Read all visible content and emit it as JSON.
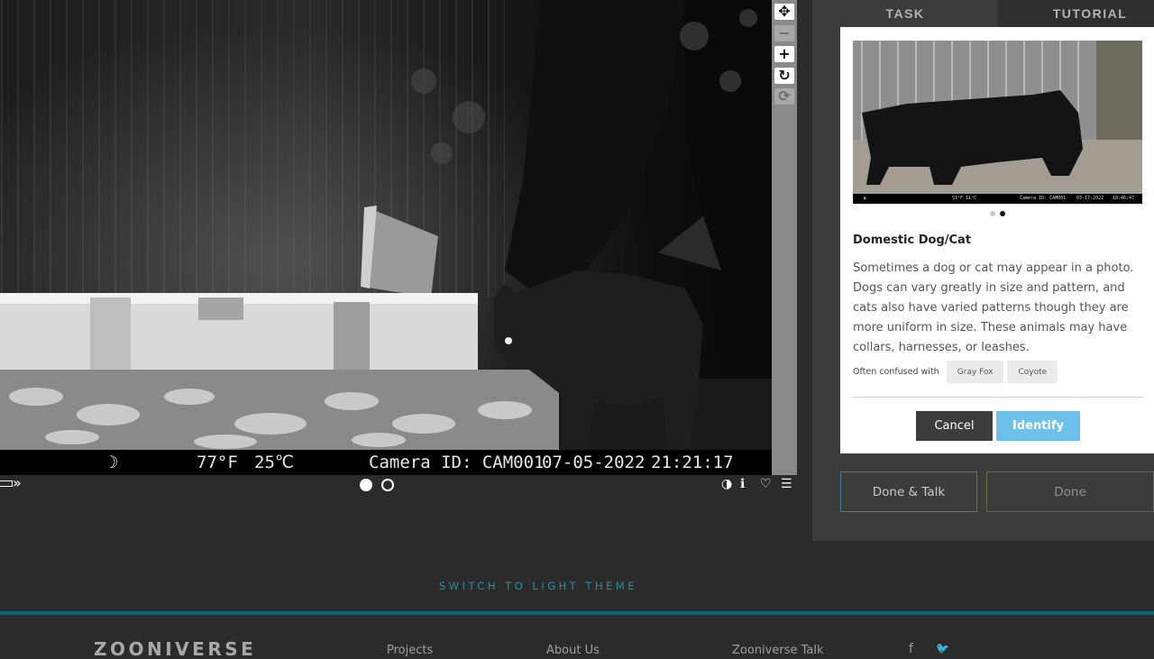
{
  "viewer": {
    "info_strip": {
      "moon": "☽",
      "temp_f": "77°F",
      "temp_c": "25℃",
      "camera_id": "Camera ID: CAM001",
      "date": "07-05-2022",
      "time": "21:21:17"
    },
    "tools": {
      "move": "✥",
      "zoom_out": "−",
      "zoom_in": "+",
      "rotate": "↻",
      "reset": "⟳"
    },
    "bar": {
      "expand": "»",
      "invert": "◑",
      "info": "ℹ",
      "favorite": "♡",
      "collections": "☰"
    }
  },
  "task_panel": {
    "tabs": {
      "task": "TASK",
      "tutorial": "TUTORIAL"
    },
    "species_card": {
      "photo_strip": {
        "moon": "◐",
        "temp": "51°F  11°C",
        "camera_id": "Camera ID: CAM001",
        "date": "03-17-2022",
        "time": "18:46:47"
      },
      "title": "Domestic Dog/Cat",
      "description": "Sometimes a dog or cat may appear in a photo. Dogs can vary greatly in size and pattern, and cats also have varied patterns though they are more uniform in size. These animals may have collars, harnesses, or leashes.",
      "confused_label": "Often confused with",
      "confused_with": [
        "Gray Fox",
        "Coyote"
      ],
      "cancel_label": "Cancel",
      "identify_label": "Identify"
    },
    "done_talk_label": "Done & Talk",
    "done_label": "Done"
  },
  "theme_switch_label": "SWITCH TO LIGHT THEME",
  "footer": {
    "logo": "ZOONIVERSE",
    "links": [
      "Projects",
      "About Us",
      "Zooniverse Talk"
    ],
    "social": {
      "facebook": "f",
      "twitter": "🐦"
    }
  },
  "colors": {
    "accent_blue": "#6cc0ea",
    "teal": "#0f6a78",
    "done_border": "#5f6d3d"
  }
}
